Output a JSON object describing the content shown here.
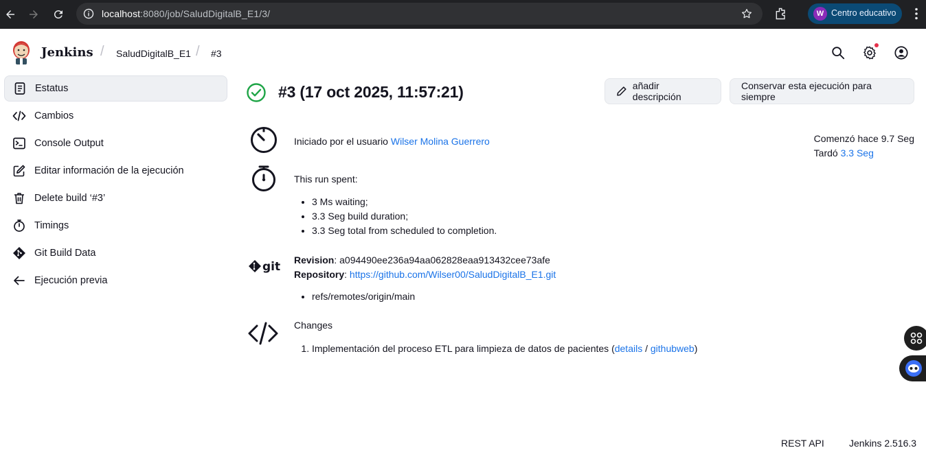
{
  "browser": {
    "url_host": "localhost",
    "url_path": ":8080/job/SaludDigitalB_E1/3/",
    "profile_initial": "W",
    "profile_label": "Centro educativo"
  },
  "header": {
    "app_title": "Jenkins",
    "breadcrumbs": [
      "SaludDigitalB_E1",
      "#3"
    ]
  },
  "sidebar": {
    "items": [
      {
        "label": "Estatus",
        "icon": "status-document-icon",
        "active": true
      },
      {
        "label": "Cambios",
        "icon": "code-icon"
      },
      {
        "label": "Console Output",
        "icon": "terminal-icon"
      },
      {
        "label": "Editar información de la ejecución",
        "icon": "edit-icon"
      },
      {
        "label": "Delete build ‘#3’",
        "icon": "trash-icon"
      },
      {
        "label": "Timings",
        "icon": "stopwatch-icon"
      },
      {
        "label": "Git Build Data",
        "icon": "git-icon"
      },
      {
        "label": "Ejecución previa",
        "icon": "arrow-left-icon"
      }
    ]
  },
  "build": {
    "title": "#3 (17 oct 2025, 11:57:21)",
    "status_color": "#1ea446",
    "add_description_label": "añadir descripción",
    "keep_forever_label": "Conservar esta ejecución para siempre",
    "started_by_prefix": "Iniciado por el usuario",
    "started_by_user": "Wilser Molina Guerrero",
    "started_ago": "Comenzó hace 9.7 Seg",
    "took_prefix": "Tardó",
    "took_value": "3.3 Seg",
    "run_spent_label": "This run spent:",
    "run_spent_items": [
      "3 Ms waiting;",
      "3.3 Seg build duration;",
      "3.3 Seg total from scheduled to completion."
    ],
    "git": {
      "revision_label": "Revision",
      "revision_value": "a094490ee236a94aa062828eaa913432cee73afe",
      "repository_label": "Repository",
      "repository_url": "https://github.com/Wilser00/SaludDigitalB_E1.git",
      "refs": [
        "refs/remotes/origin/main"
      ]
    },
    "changes": {
      "label": "Changes",
      "items": [
        {
          "text": "Implementación del proceso ETL para limpieza de datos de pacientes (",
          "details": "details",
          "sep": " / ",
          "web": "githubweb",
          "close": ")"
        }
      ]
    }
  },
  "footer": {
    "rest_api": "REST API",
    "version": "Jenkins 2.516.3"
  }
}
